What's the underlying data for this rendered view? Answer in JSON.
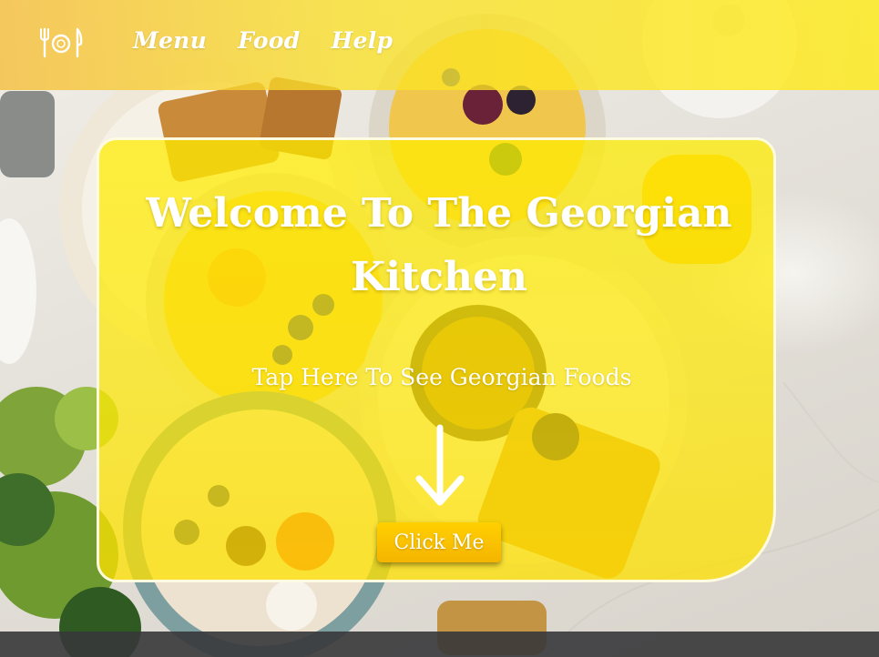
{
  "nav": {
    "logo_icon": "fork-plate-knife-icon",
    "links": [
      {
        "label": "Menu"
      },
      {
        "label": "Food"
      },
      {
        "label": "Help"
      }
    ]
  },
  "hero": {
    "title_line1": "Welcome To The Georgian",
    "title_line2": "Kitchen",
    "subtitle": "Tap Here To See Georgian Foods",
    "arrow_icon": "arrow-down-icon",
    "button_label": "Click Me"
  },
  "colors": {
    "nav_overlay": "#f8d232",
    "hero_overlay": "#ffe800",
    "button": "#fbc400",
    "text": "#ffffff",
    "footer": "#37373a"
  }
}
